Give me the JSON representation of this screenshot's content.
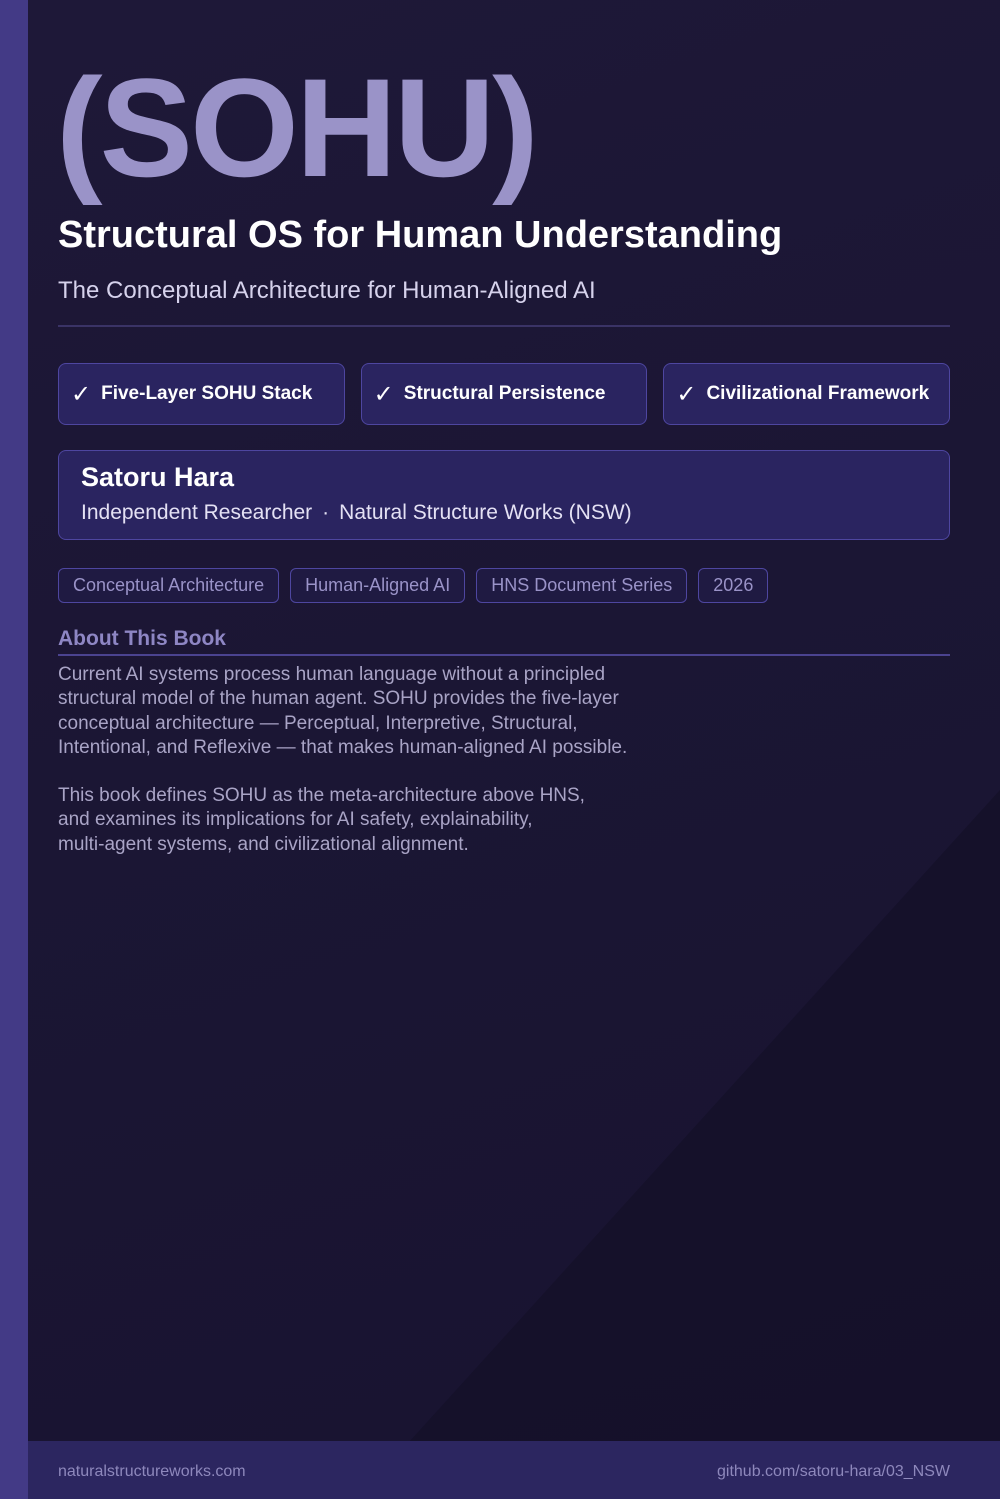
{
  "cover": {
    "title": "(SOHU)",
    "subtitle": "Structural OS for Human Understanding",
    "tagline": "The Conceptual Architecture for Human-Aligned AI"
  },
  "features": [
    {
      "icon": "check-icon",
      "label": "Five-Layer SOHU Stack"
    },
    {
      "icon": "check-icon",
      "label": "Structural Persistence"
    },
    {
      "icon": "check-icon",
      "label": "Civilizational Framework"
    }
  ],
  "author": {
    "name": "Satoru Hara",
    "role": "Independent Researcher",
    "separator": "·",
    "organization": "Natural Structure Works (NSW)"
  },
  "tags": [
    "Conceptual Architecture",
    "Human-Aligned AI",
    "HNS Document Series",
    "2026"
  ],
  "about": {
    "heading": "About This Book",
    "paragraphs": [
      "Current AI systems process human language without a principled\nstructural model of the human agent. SOHU provides the five-layer\nconceptual architecture — Perceptual, Interpretive, Structural,\nIntentional, and Reflexive — that makes human-aligned AI possible.",
      "This book defines SOHU as the meta-architecture above HNS,\nand examines its implications for AI safety, explainability,\nmulti-agent systems, and civilizational alignment."
    ]
  },
  "footer": {
    "left": "naturalstructureworks.com",
    "right": "github.com/satoru-hara/03_NSW"
  },
  "colors": {
    "background": "#1b1634",
    "accent_bar": "#433a86",
    "title": "#9a93c8",
    "card_fill": "#2a2460",
    "card_border": "#4e46a0",
    "footer_fill": "#2c2660"
  }
}
